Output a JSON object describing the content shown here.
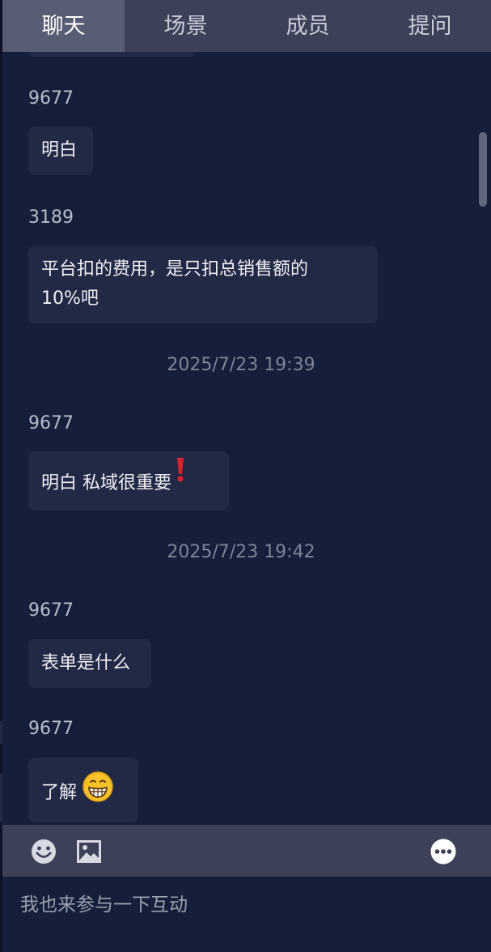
{
  "tabs": [
    {
      "label": "聊天",
      "active": true
    },
    {
      "label": "场景",
      "active": false
    },
    {
      "label": "成员",
      "active": false
    },
    {
      "label": "提问",
      "active": false
    }
  ],
  "messages": [
    {
      "sender": "9677",
      "text": "明白"
    },
    {
      "sender": "3189",
      "text_line1": "平台扣的费用，是只扣总销售额的",
      "text_line2": "10%吧"
    },
    {
      "timestamp": "2025/7/23 19:39"
    },
    {
      "sender": "9677",
      "text": "明白 私域很重要",
      "emoji": "red-exclamation-icon"
    },
    {
      "timestamp": "2025/7/23 19:42"
    },
    {
      "sender": "9677",
      "text": "表单是什么"
    },
    {
      "sender": "9677",
      "text": "了解",
      "emoji": "grinning-face-icon"
    }
  ],
  "toolbar": {
    "icons": [
      "smiley-icon",
      "image-icon",
      "more-icon"
    ]
  },
  "input": {
    "placeholder": "我也来参与一下互动"
  },
  "colors": {
    "background": "#161f3a",
    "tab_bar": "#3c4158",
    "tab_active": "#575d72",
    "bubble": "#222944",
    "sender_text": "#b6bccb",
    "timestamp_text": "#7d8497"
  }
}
